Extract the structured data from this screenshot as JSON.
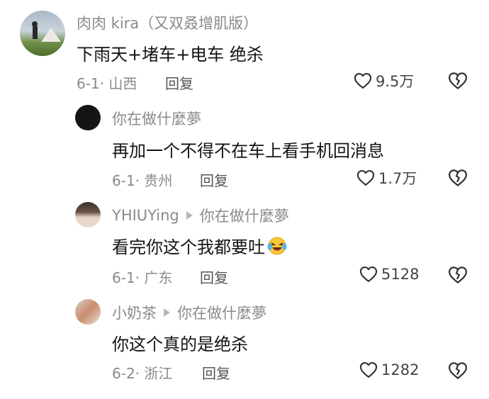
{
  "comments": [
    {
      "username": "肉肉 kira（又双叒增肌版）",
      "text": "下雨天+堵车+电车 绝杀",
      "date": "6-1",
      "location": "山西",
      "reply_label": "回复",
      "likes": "9.5万"
    },
    {
      "username": "你在做什麼夢",
      "text": "再加一个不得不在车上看手机回消息",
      "date": "6-1",
      "location": "贵州",
      "reply_label": "回复",
      "likes": "1.7万"
    },
    {
      "username": "YHIUYing",
      "reply_to": "你在做什麼夢",
      "text": "看完你这个我都要吐",
      "emoji": "laughing-crying-emoji",
      "date": "6-1",
      "location": "广东",
      "reply_label": "回复",
      "likes": "5128"
    },
    {
      "username": "小奶茶",
      "reply_to": "你在做什麼夢",
      "text": "你这个真的是绝杀",
      "date": "6-2",
      "location": "浙江",
      "reply_label": "回复",
      "likes": "1282"
    }
  ],
  "colors": {
    "meta": "#8a8a8a",
    "text": "#141414",
    "icon": "#333333"
  }
}
